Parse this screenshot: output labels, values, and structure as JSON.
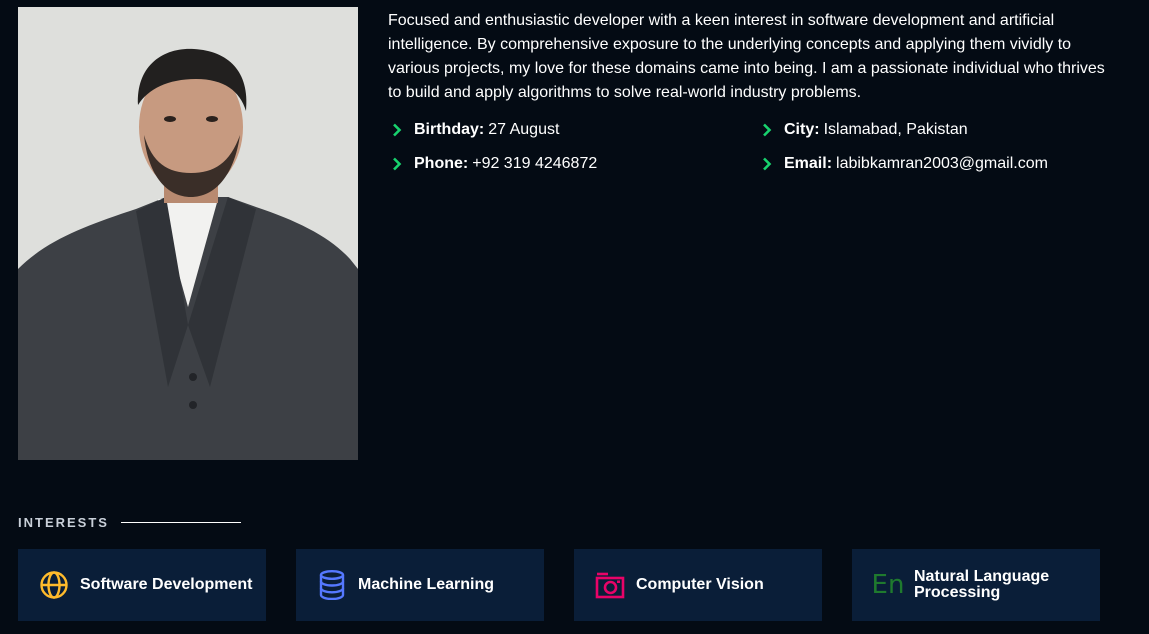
{
  "about": {
    "bio": "Focused and enthusiastic developer with a keen interest in software development and artificial intelligence. By comprehensive exposure to the underlying concepts and applying them vividly to various projects, my love for these domains came into being. I am a passionate individual who thrives to build and apply algorithms to solve real-world industry problems.",
    "details": [
      {
        "label": "Birthday:",
        "value": "27 August"
      },
      {
        "label": "City:",
        "value": "Islamabad, Pakistan"
      },
      {
        "label": "Phone:",
        "value": "+92 319 4246872"
      },
      {
        "label": "Email:",
        "value": "labibkamran2003@gmail.com"
      }
    ],
    "detail_icon": "chevron-right-icon"
  },
  "interests": {
    "title": "INTERESTS",
    "items": [
      {
        "label": "Software Development",
        "icon": "globe-icon",
        "color": "#ffbb2c"
      },
      {
        "label": "Machine Learning",
        "icon": "database-icon",
        "color": "#5578ff"
      },
      {
        "label": "Computer Vision",
        "icon": "camera-icon",
        "color": "#e80368"
      },
      {
        "label": "Natural Language Processing",
        "icon": "en-letters-icon",
        "icon_text": "En",
        "color": "#1f7a2e"
      }
    ]
  },
  "colors": {
    "background": "#040b14",
    "accent": "#18d26e",
    "card": "#0a1e38"
  }
}
